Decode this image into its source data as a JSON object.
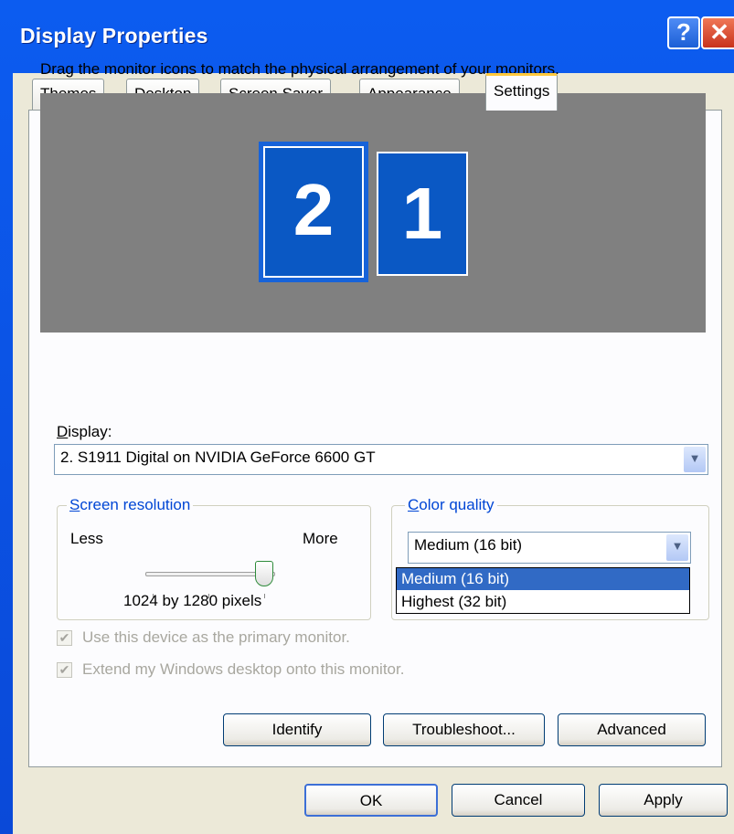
{
  "window": {
    "title": "Display Properties"
  },
  "titlebar": {
    "help_glyph": "?",
    "close_glyph": "✕"
  },
  "tabs": [
    "Themes",
    "Desktop",
    "Screen Saver",
    "Appearance",
    "Settings"
  ],
  "settings": {
    "instruction": "Drag the monitor icons to match the physical arrangement of your monitors.",
    "monitors": [
      "2",
      "1"
    ],
    "display_label": "Display:",
    "display_value": "2. S1911 Digital on NVIDIA GeForce 6600 GT",
    "resolution": {
      "title": "Screen resolution",
      "less": "Less",
      "more": "More",
      "value": "1024 by 1280 pixels"
    },
    "color": {
      "title": "Color quality",
      "selected": "Medium (16 bit)",
      "options": [
        "Medium (16 bit)",
        "Highest (32 bit)"
      ]
    },
    "checkboxes": [
      "Use this device as the primary monitor.",
      "Extend my Windows desktop onto this monitor."
    ],
    "buttons": {
      "identify": "Identify",
      "troubleshoot": "Troubleshoot...",
      "advanced": "Advanced"
    }
  },
  "dialog_buttons": {
    "ok": "OK",
    "cancel": "Cancel",
    "apply": "Apply"
  },
  "colors": {
    "titlebar": "#0a58e0",
    "monitor": "#0a58c4",
    "selection": "#316ac5",
    "active_tab": "#ffc83c"
  }
}
